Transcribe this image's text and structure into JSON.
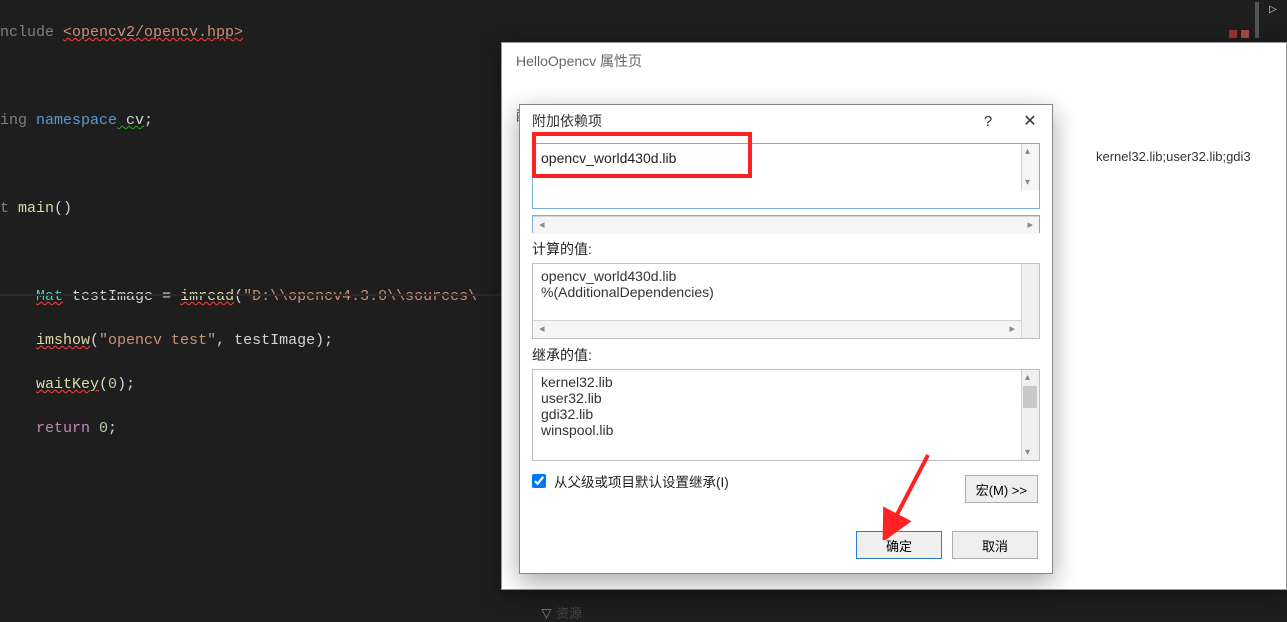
{
  "code": {
    "l1_prefix": "nclude ",
    "l1_inc": "<opencv2/opencv.hpp>",
    "l2_using": "ing ",
    "l2_ns": "namespace",
    "l2_cv": " cv",
    "l3_t": "t ",
    "l3_main": "main",
    "l3_paren": "()",
    "l5_mat": "Mat",
    "l5_var": " testImage = ",
    "l5_fn": "imread",
    "l5_str": "\"D:\\\\opencv4.3.0\\\\sources\\",
    "l6_fn": "imshow",
    "l6_args_str": "\"opencv test\"",
    "l6_args_rest": ", testImage);",
    "l7_fn": "waitKey",
    "l7_args": "(",
    "l7_num": "0",
    "l7_close": ");",
    "l8_ret": "return",
    "l8_num": " 0",
    "l8_semi": ";"
  },
  "propsheet": {
    "title": "HelloOpencv 属性页",
    "side_label": "配",
    "tree_node": "资源",
    "tree_arrow": "▷",
    "right_value": "kernel32.lib;user32.lib;gdi3"
  },
  "dialog": {
    "title": "附加依赖项",
    "help": "?",
    "close": "✕",
    "textedit_value": "opencv_world430d.lib",
    "computed_label": "计算的值:",
    "computed_lines": [
      "opencv_world430d.lib",
      "%(AdditionalDependencies)"
    ],
    "inherited_label": "继承的值:",
    "inherited_lines": [
      "kernel32.lib",
      "user32.lib",
      "gdi32.lib",
      "winspool.lib"
    ],
    "inherit_checkbox_label": "从父级或项目默认设置继承(I)",
    "inherit_checked": true,
    "macro_button": "宏(M) >>",
    "ok": "确定",
    "cancel": "取消"
  }
}
